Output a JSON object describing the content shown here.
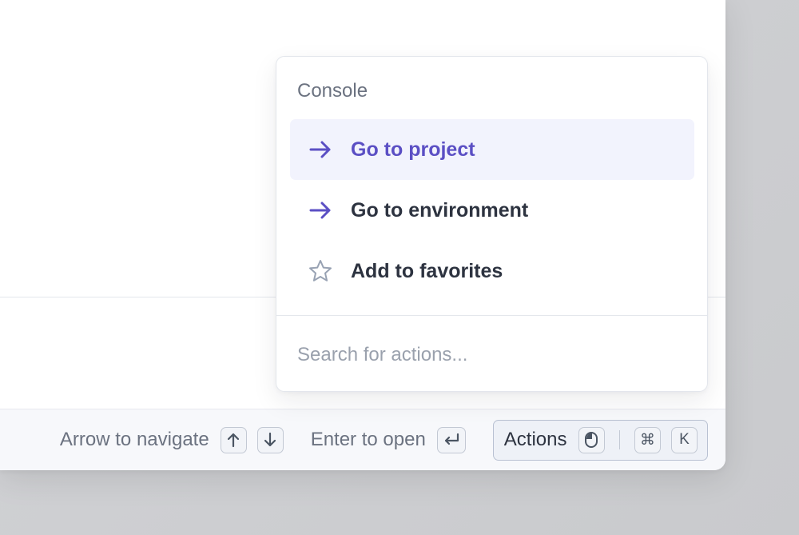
{
  "menu": {
    "section_title": "Console",
    "items": [
      {
        "label": "Go to project",
        "icon": "arrow-right-icon",
        "active": true
      },
      {
        "label": "Go to environment",
        "icon": "arrow-right-icon",
        "active": false
      },
      {
        "label": "Add to favorites",
        "icon": "star-outline-icon",
        "active": false
      }
    ],
    "search_placeholder": "Search for actions..."
  },
  "footer": {
    "navigate_hint": "Arrow to navigate",
    "navigate_keys": [
      "arrow-up-icon",
      "arrow-down-icon"
    ],
    "open_hint": "Enter to open",
    "open_key": "enter-return-icon",
    "actions_label": "Actions",
    "actions_mouse_icon": "mouse-icon",
    "shortcut_cmd": "⌘",
    "shortcut_key": "K"
  },
  "colors": {
    "accent": "#5b4fc4",
    "active_item_bg": "#f2f3fd",
    "text_primary": "#2d3340",
    "text_muted": "#6b7280"
  }
}
